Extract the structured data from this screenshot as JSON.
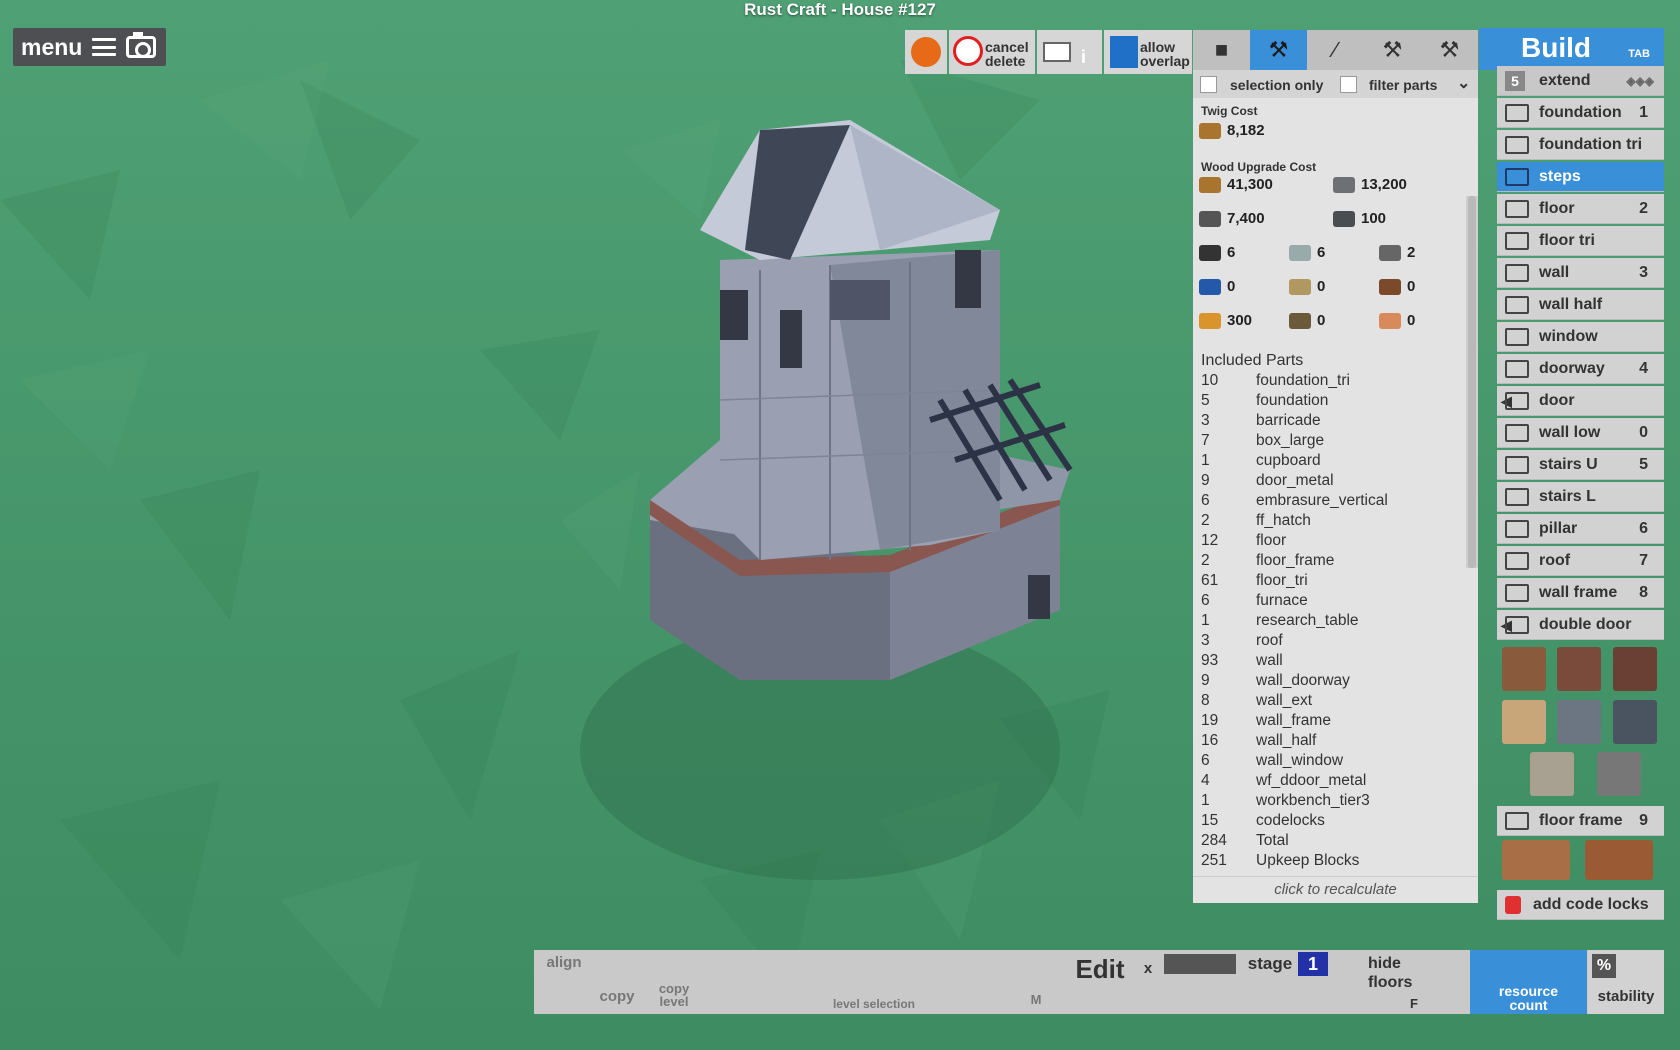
{
  "window_title": "Rust Craft - House #127",
  "menu": {
    "label": "menu",
    "icons": [
      "hamburger-icon",
      "camera-icon"
    ]
  },
  "top_toolbar": {
    "cancel_delete": "cancel\ndelete",
    "allow_overlap": "allow\noverlap",
    "cam_hint": "i"
  },
  "tools": [
    "cube-icon",
    "hammer-icon",
    "wrench-icon",
    "tool-icon",
    "pickaxe-icon"
  ],
  "filters": {
    "selection_only": "selection only",
    "filter_parts": "filter parts"
  },
  "costs": {
    "twig_title": "Twig Cost",
    "twig": [
      {
        "icon": "twig-wood-icon",
        "value": "8,182"
      }
    ],
    "wood_title": "Wood Upgrade Cost",
    "wood": [
      {
        "icon": "wood-icon",
        "value": "41,300"
      },
      {
        "icon": "stone-icon",
        "value": "13,200"
      },
      {
        "icon": "metal-frag-icon",
        "value": "7,400"
      },
      {
        "icon": "hq-metal-icon",
        "value": "100"
      },
      {
        "icon": "gear-icon",
        "value": "6"
      },
      {
        "icon": "sheet-icon",
        "value": "6"
      },
      {
        "icon": "pipe-icon",
        "value": "2"
      },
      {
        "icon": "tarp-icon",
        "value": "0"
      },
      {
        "icon": "cloth-icon",
        "value": "0"
      },
      {
        "icon": "barrel-icon",
        "value": "0"
      },
      {
        "icon": "lowgrade-icon",
        "value": "300"
      },
      {
        "icon": "rope-icon",
        "value": "0"
      },
      {
        "icon": "leather-icon",
        "value": "0"
      }
    ]
  },
  "included_parts": {
    "title": "Included Parts",
    "rows": [
      [
        "10",
        "foundation_tri"
      ],
      [
        "5",
        "foundation"
      ],
      [
        "3",
        "barricade"
      ],
      [
        "7",
        "box_large"
      ],
      [
        "1",
        "cupboard"
      ],
      [
        "9",
        "door_metal"
      ],
      [
        "6",
        "embrasure_vertical"
      ],
      [
        "2",
        "ff_hatch"
      ],
      [
        "12",
        "floor"
      ],
      [
        "2",
        "floor_frame"
      ],
      [
        "61",
        "floor_tri"
      ],
      [
        "6",
        "furnace"
      ],
      [
        "1",
        "research_table"
      ],
      [
        "3",
        "roof"
      ],
      [
        "93",
        "wall"
      ],
      [
        "9",
        "wall_doorway"
      ],
      [
        "8",
        "wall_ext"
      ],
      [
        "19",
        "wall_frame"
      ],
      [
        "16",
        "wall_half"
      ],
      [
        "6",
        "wall_window"
      ],
      [
        "4",
        "wf_ddoor_metal"
      ],
      [
        "1",
        "workbench_tier3"
      ],
      [
        "15",
        "codelocks"
      ],
      [
        "284",
        "Total"
      ],
      [
        "251",
        "Upkeep Blocks"
      ]
    ],
    "recalc": "click to recalculate"
  },
  "build": {
    "title": "Build",
    "tab_hint": "TAB",
    "extend_count": "5",
    "extend_label": "extend",
    "items": [
      {
        "label": "foundation",
        "key": "1",
        "icon": "foundation-icon"
      },
      {
        "label": "foundation tri",
        "key": "",
        "icon": "foundation-tri-icon"
      },
      {
        "label": "steps",
        "key": "",
        "icon": "steps-icon",
        "active": true
      },
      {
        "label": "floor",
        "key": "2",
        "icon": "floor-icon"
      },
      {
        "label": "floor tri",
        "key": "",
        "icon": "floor-tri-icon"
      },
      {
        "label": "wall",
        "key": "3",
        "icon": "wall-icon"
      },
      {
        "label": "wall half",
        "key": "",
        "icon": "wall-half-icon"
      },
      {
        "label": "window",
        "key": "",
        "icon": "window-icon"
      },
      {
        "label": "doorway",
        "key": "4",
        "icon": "doorway-icon"
      },
      {
        "label": "door",
        "key": "",
        "icon": "door-icon"
      },
      {
        "label": "wall low",
        "key": "0",
        "icon": "wall-low-icon"
      },
      {
        "label": "stairs U",
        "key": "5",
        "icon": "stairs-u-icon"
      },
      {
        "label": "stairs L",
        "key": "",
        "icon": "stairs-l-icon"
      },
      {
        "label": "pillar",
        "key": "6",
        "icon": "pillar-icon"
      },
      {
        "label": "roof",
        "key": "7",
        "icon": "roof-icon"
      },
      {
        "label": "wall frame",
        "key": "8",
        "icon": "wall-frame-icon"
      },
      {
        "label": "double door",
        "key": "",
        "icon": "double-door-icon"
      },
      {
        "label": "floor frame",
        "key": "9",
        "icon": "floor-frame-icon"
      }
    ],
    "add_code_locks": "add code locks"
  },
  "bottom": {
    "align": "align",
    "copy": "copy",
    "copy_level": "copy\nlevel",
    "level_selection": "level selection",
    "m_key": "M",
    "edit": "Edit",
    "edit_close": "x",
    "stage_label": "stage",
    "stage_value": "1",
    "hide_floors": "hide\nfloors",
    "f_key": "F",
    "resource_count": "resource\ncount",
    "percent": "%",
    "stability": "stability"
  }
}
